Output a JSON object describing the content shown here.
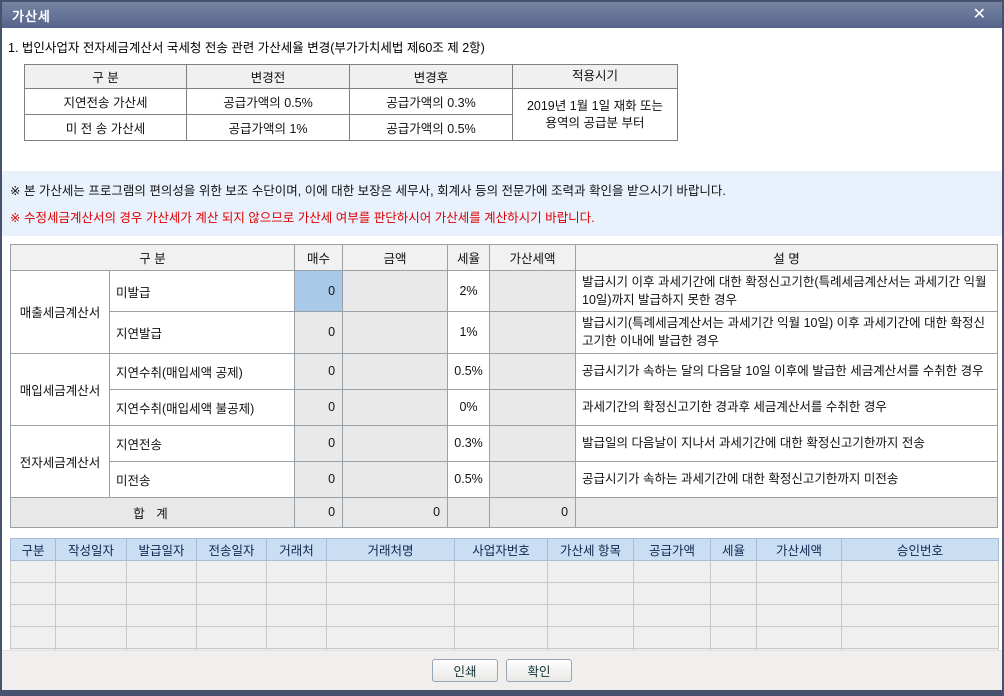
{
  "dialog": {
    "title": "가산세",
    "close_glyph": "✕"
  },
  "intro": "1. 법인사업자 전자세금계산서 국세청 전송 관련 가산세율 변경(부가가치세법 제60조 제 2항)",
  "change_table": {
    "headers": {
      "gubun": "구  분",
      "before": "변경전",
      "after": "변경후",
      "period": "적용시기"
    },
    "rows": [
      {
        "gubun": "지연전송 가산세",
        "before": "공급가액의 0.5%",
        "after": "공급가액의 0.3%"
      },
      {
        "gubun": "미 전 송  가산세",
        "before": "공급가액의   1%",
        "after": "공급가액의  0.5%"
      }
    ],
    "period_line1": "2019년 1월 1일 재화 또는",
    "period_line2": "용역의 공급분 부터"
  },
  "notices": {
    "notice_black": "※ 본 가산세는 프로그램의 편의성을 위한 보조 수단이며, 이에 대한 보장은 세무사, 회계사 등의 전문가에 조력과 확인을 받으시기 바랍니다.",
    "notice_red": "※ 수정세금계산서의 경우 가산세가 계산 되지 않으므로 가산세 여부를 판단하시어 가산세를 계산하시기 바랍니다."
  },
  "penalty_table": {
    "headers": {
      "gubun": "구   분",
      "count": "매수",
      "amount": "금액",
      "rate": "세율",
      "penalty": "가산세액",
      "desc": "설   명"
    },
    "rows": [
      {
        "group": "매출세금계산서",
        "item": "미발급",
        "count": "0",
        "amount": "",
        "rate": "2%",
        "penalty": "",
        "desc": "발급시기 이후 과세기간에 대한 확정신고기한(특례세금계산서는 과세기간 익월 10일)까지 발급하지 못한 경우"
      },
      {
        "group": "",
        "item": "지연발급",
        "count": "0",
        "amount": "",
        "rate": "1%",
        "penalty": "",
        "desc": "발급시기(특례세금계산서는 과세기간 익월 10일) 이후 과세기간에 대한 확정신고기한 이내에 발급한 경우"
      },
      {
        "group": "매입세금계산서",
        "item": "지연수취(매입세액 공제)",
        "count": "0",
        "amount": "",
        "rate": "0.5%",
        "penalty": "",
        "desc": "공급시기가 속하는 달의 다음달 10일 이후에 발급한 세금계산서를 수취한 경우"
      },
      {
        "group": "",
        "item": "지연수취(매입세액 불공제)",
        "count": "0",
        "amount": "",
        "rate": "0%",
        "penalty": "",
        "desc": "과세기간의 확정신고기한 경과후 세금계산서를 수취한 경우"
      },
      {
        "group": "전자세금계산서",
        "item": "지연전송",
        "count": "0",
        "amount": "",
        "rate": "0.3%",
        "penalty": "",
        "desc": "발급일의 다음날이 지나서 과세기간에 대한 확정신고기한까지 전송"
      },
      {
        "group": "",
        "item": "미전송",
        "count": "0",
        "amount": "",
        "rate": "0.5%",
        "penalty": "",
        "desc": "공급시기가 속하는 과세기간에 대한 확정신고기한까지 미전송"
      }
    ],
    "total": {
      "label": "합    계",
      "count": "0",
      "amount": "0",
      "rate": "",
      "penalty": "0",
      "desc": ""
    }
  },
  "detail_table": {
    "headers": [
      "구분",
      "작성일자",
      "발급일자",
      "전송일자",
      "거래처",
      "거래처명",
      "사업자번호",
      "가산세 항목",
      "공급가액",
      "세율",
      "가산세액",
      "승인번호"
    ],
    "empty_row_count": 5
  },
  "footer": {
    "print_label": "인쇄",
    "ok_label": "확인"
  },
  "colors": {
    "titlebar": "#68779a",
    "dialog_border": "#47536e",
    "notice_bg": "#e9f2fc",
    "notice_red": "#dd0000",
    "selected_cell": "#a9c9e9",
    "readonly_cell": "#e9e9e9",
    "detail_header_bg": "#c9ddf3"
  }
}
